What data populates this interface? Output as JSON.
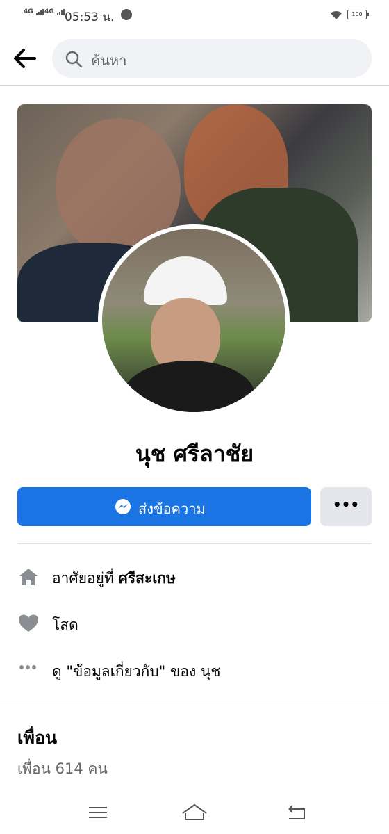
{
  "status_bar": {
    "signal1": "4G",
    "signal2": "4G",
    "time": "05:53 น.",
    "battery": "100"
  },
  "header": {
    "search_placeholder": "ค้นหา"
  },
  "profile": {
    "name": "นุช ศรีลาชัย"
  },
  "actions": {
    "message_label": "ส่งข้อความ",
    "more_label": "•••"
  },
  "info": {
    "lives_in_prefix": "อาศัยอยู่ที่ ",
    "lives_in_place": "ศรีสะเกษ",
    "relationship": "โสด",
    "about_link": "ดู \"ข้อมูลเกี่ยวกับ\" ของ นุช"
  },
  "friends": {
    "title": "เพื่อน",
    "count": "เพื่อน 614 คน"
  },
  "icons": {
    "back": "back-arrow-icon",
    "search": "search-icon",
    "messenger": "messenger-icon",
    "home": "home-icon",
    "heart": "heart-icon",
    "more": "more-dots-icon"
  },
  "colors": {
    "primary": "#1b74e4",
    "secondary_button": "#e4e6eb",
    "search_bg": "#f0f2f5",
    "info_icon": "#8a8d91"
  }
}
